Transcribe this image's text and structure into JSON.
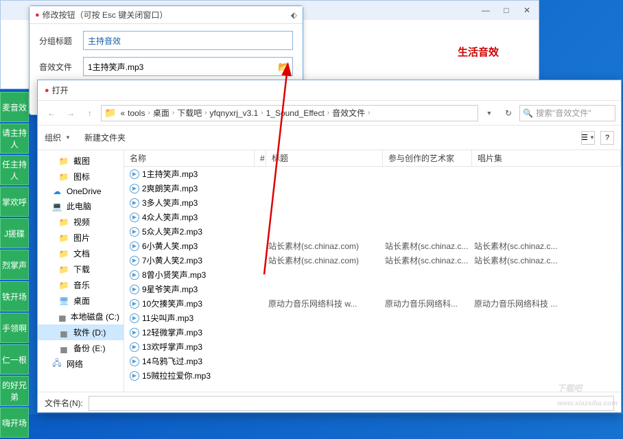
{
  "main_window": {
    "right_panel_title": "生活音效"
  },
  "edit_dialog": {
    "title": "修改按钮（可按 Esc 键关闭窗口）",
    "group_label": "分组标题",
    "group_value": "主持音效",
    "file_label": "音效文件",
    "file_value": "1主持笑声.mp3"
  },
  "sidebar": {
    "items": [
      "麦音效",
      "请主持人",
      "任主持人",
      "掌欢呼",
      "J搓碟",
      "烈掌声",
      "铁开场",
      "手领啊",
      "仁一根",
      "的好兄弟",
      "嗨开场"
    ]
  },
  "open_dialog": {
    "title": "打开",
    "breadcrumb": [
      "tools",
      "桌面",
      "下载吧",
      "yfqnyxrj_v3.1",
      "1_Sound_Effect",
      "音效文件"
    ],
    "search_placeholder": "搜索\"音效文件\"",
    "toolbar_organize": "组织",
    "toolbar_new_folder": "新建文件夹",
    "tree": [
      {
        "label": "截图",
        "icon": "folder",
        "indent": true
      },
      {
        "label": "图标",
        "icon": "folder",
        "indent": true
      },
      {
        "label": "OneDrive",
        "icon": "onedrive",
        "indent": false
      },
      {
        "label": "此电脑",
        "icon": "pc",
        "indent": false
      },
      {
        "label": "视频",
        "icon": "folder",
        "indent": true
      },
      {
        "label": "图片",
        "icon": "folder",
        "indent": true
      },
      {
        "label": "文档",
        "icon": "folder",
        "indent": true
      },
      {
        "label": "下载",
        "icon": "folder",
        "indent": true
      },
      {
        "label": "音乐",
        "icon": "folder",
        "indent": true
      },
      {
        "label": "桌面",
        "icon": "desktop",
        "indent": true
      },
      {
        "label": "本地磁盘 (C:)",
        "icon": "disk",
        "indent": true
      },
      {
        "label": "软件 (D:)",
        "icon": "disk",
        "indent": true,
        "selected": true
      },
      {
        "label": "备份 (E:)",
        "icon": "disk",
        "indent": true
      },
      {
        "label": "网络",
        "icon": "network",
        "indent": false
      }
    ],
    "columns": {
      "name": "名称",
      "title": "标题",
      "artist": "参与创作的艺术家",
      "album": "唱片集"
    },
    "files": [
      {
        "name": "1主持笑声.mp3"
      },
      {
        "name": "2爽朗笑声.mp3"
      },
      {
        "name": "3多人笑声.mp3"
      },
      {
        "name": "4众人笑声.mp3"
      },
      {
        "name": "5众人笑声2.mp3"
      },
      {
        "name": "6小黄人笑.mp3",
        "title": "站长素材(sc.chinaz.com)",
        "artist": "站长素材(sc.chinaz.c...",
        "album": "站长素材(sc.chinaz.c..."
      },
      {
        "name": "7小黄人笑2.mp3",
        "title": "站长素材(sc.chinaz.com)",
        "artist": "站长素材(sc.chinaz.c...",
        "album": "站长素材(sc.chinaz.c..."
      },
      {
        "name": "8曾小贤笑声.mp3"
      },
      {
        "name": "9星爷笑声.mp3"
      },
      {
        "name": "10欠揍笑声.mp3",
        "title": "原动力音乐网络科技 w...",
        "artist": "原动力音乐网络科...",
        "album": "原动力音乐网络科技 ..."
      },
      {
        "name": "11尖叫声.mp3"
      },
      {
        "name": "12轻微掌声.mp3"
      },
      {
        "name": "13欢呼掌声.mp3"
      },
      {
        "name": "14乌鸦飞过.mp3"
      },
      {
        "name": "15贼拉拉爱你.mp3"
      }
    ],
    "filename_label": "文件名(N):"
  },
  "watermark": "下载吧"
}
